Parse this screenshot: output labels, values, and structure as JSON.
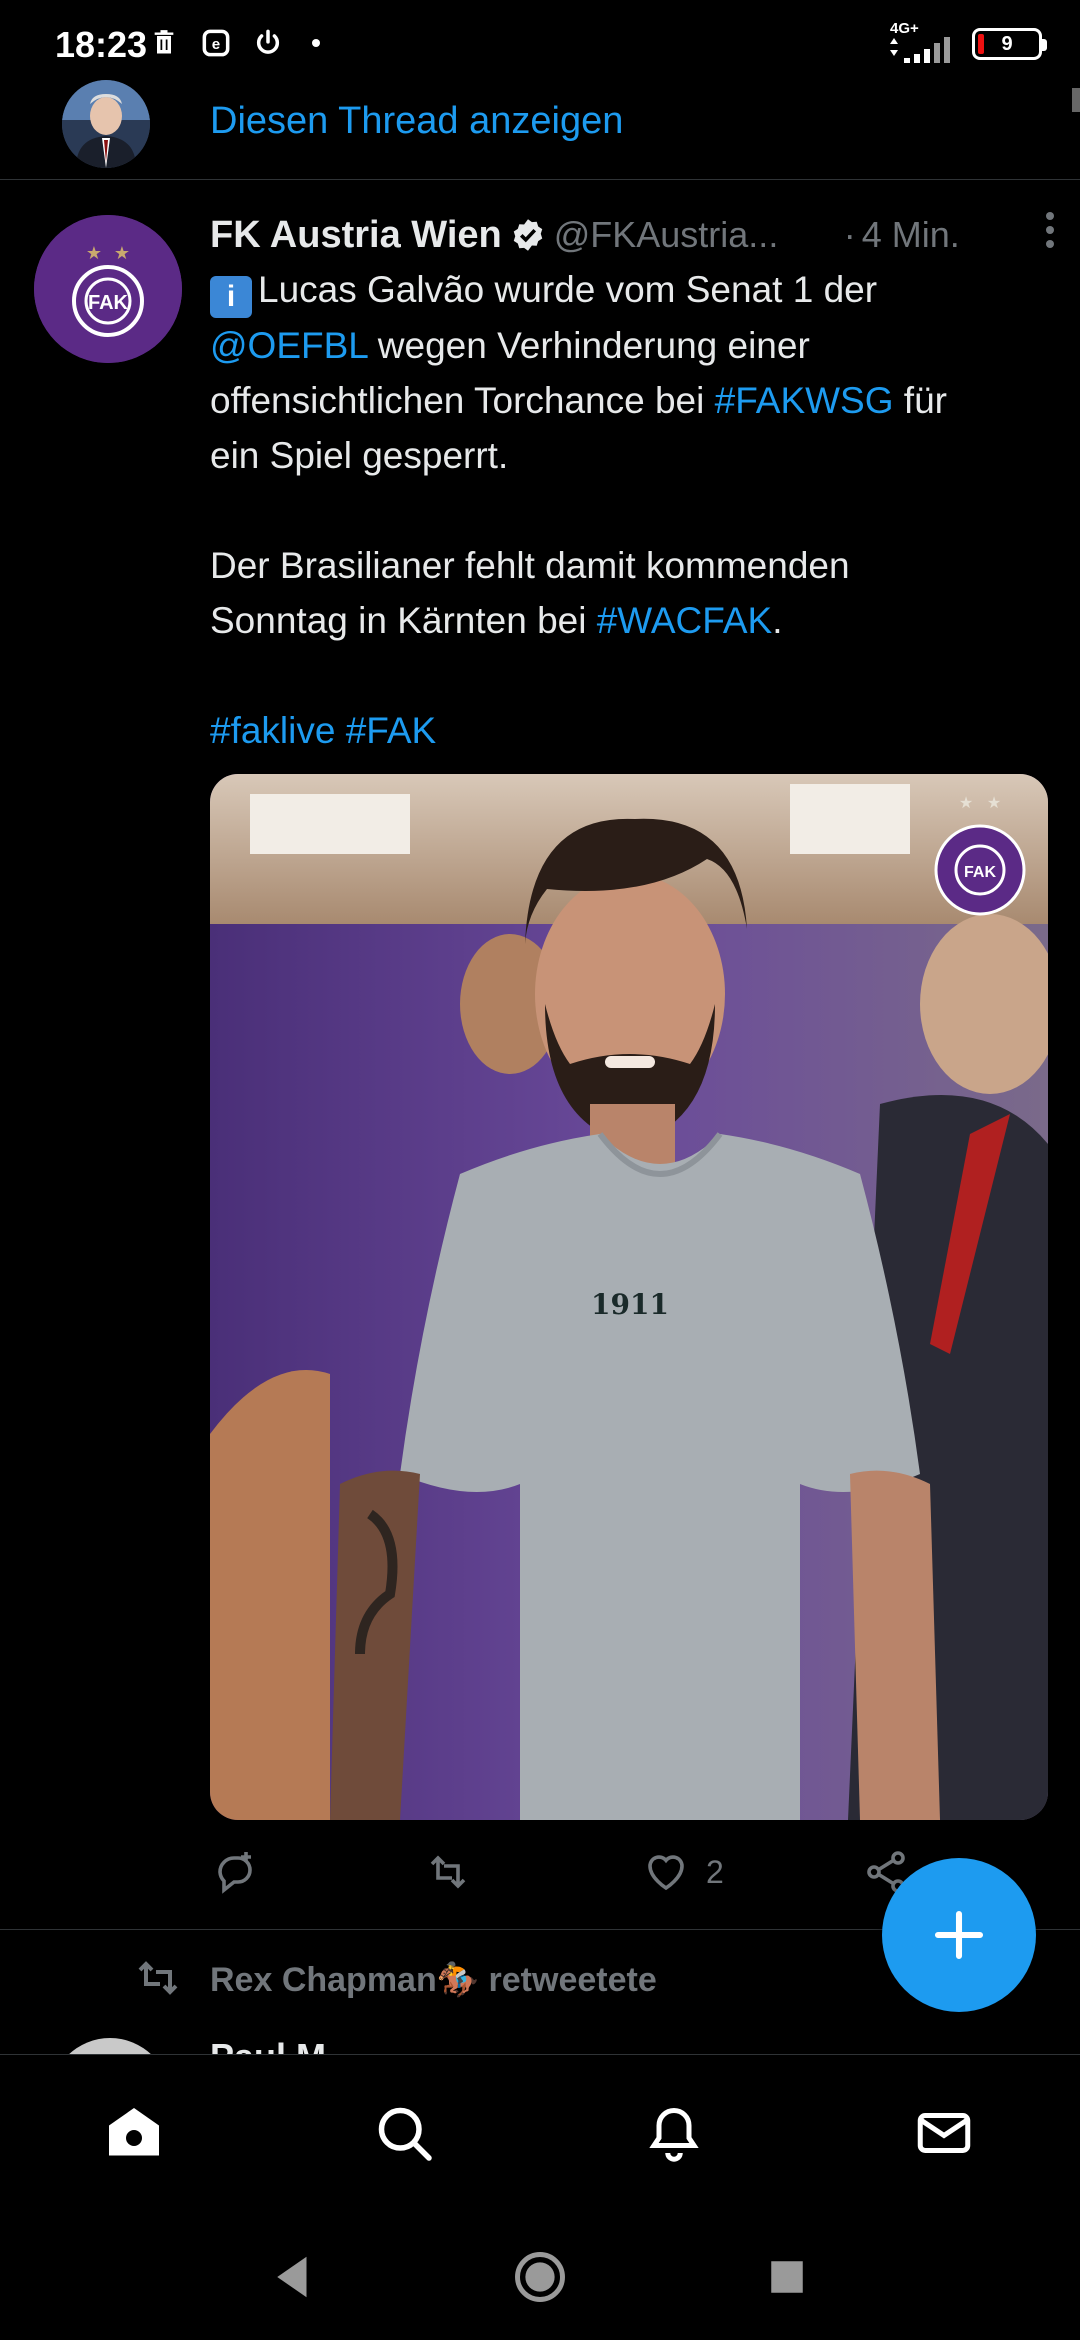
{
  "status_bar": {
    "time": "18:23",
    "network": "4G+",
    "battery": "9"
  },
  "thread": {
    "link_label": "Diesen Thread anzeigen"
  },
  "tweet": {
    "author_name": "FK Austria Wien",
    "author_handle": "@FKAustria...",
    "separator": "·",
    "time": "4 Min.",
    "info_glyph": "i",
    "body_line1_text": "Lucas Galvão wurde vom Senat 1 der",
    "mention": "@OEFBL",
    "body_line2_text": " wegen Verhinderung einer",
    "body_line3_text": "offensichtlichen Torchance bei ",
    "hashtag_fakwsg": "#FAKWSG",
    "body_line3_tail": " für",
    "body_line4_text": "ein Spiel gesperrt.",
    "body_para2": "Der Brasilianer fehlt damit kommenden Sonntag in Kärnten bei ",
    "hashtag_wacfak": "#WACFAK",
    "period": ".",
    "hashtag_faklive": "#faklive",
    "hashtag_fak": "#FAK",
    "shirt_text": "1911",
    "like_count": "2"
  },
  "retweet_row": {
    "user": "Rex Chapman",
    "emoji": "🏇",
    "suffix": "retweetete"
  },
  "next_tweet": {
    "author_peek": "Paul M..."
  },
  "colors": {
    "accent": "#1d9bf0",
    "background": "#000000",
    "secondary_text": "#71767b",
    "fak_purple": "#5b2a86"
  }
}
